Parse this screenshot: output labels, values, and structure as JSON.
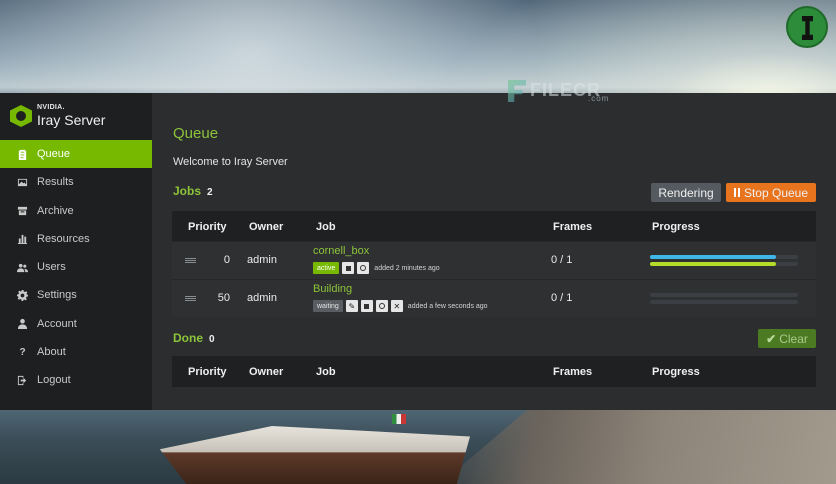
{
  "watermark": {
    "text": "FILECR",
    "sub": ".com"
  },
  "brand": {
    "small": "NVIDIA.",
    "name": "Iray Server"
  },
  "nav": [
    {
      "label": "Queue",
      "icon": "clipboard-icon",
      "active": true
    },
    {
      "label": "Results",
      "icon": "image-icon",
      "active": false
    },
    {
      "label": "Archive",
      "icon": "archive-icon",
      "active": false
    },
    {
      "label": "Resources",
      "icon": "bar-chart-icon",
      "active": false
    },
    {
      "label": "Users",
      "icon": "users-icon",
      "active": false
    },
    {
      "label": "Settings",
      "icon": "gear-icon",
      "active": false
    },
    {
      "label": "Account",
      "icon": "user-icon",
      "active": false
    },
    {
      "label": "About",
      "icon": "question-icon",
      "active": false
    },
    {
      "label": "Logout",
      "icon": "logout-icon",
      "active": false
    }
  ],
  "main": {
    "title": "Queue",
    "welcome": "Welcome to Iray Server",
    "jobs": {
      "label": "Jobs",
      "count": "2",
      "rendering_label": "Rendering",
      "stop_label": "Stop Queue",
      "columns": [
        "Priority",
        "Owner",
        "Job",
        "Frames",
        "Progress"
      ],
      "rows": [
        {
          "priority": "0",
          "owner": "admin",
          "job": "cornell_box",
          "status": "active",
          "added": "added 2 minutes ago",
          "frames": "0 / 1",
          "progress": [
            {
              "fraction": 0.85,
              "color": "#3fb6e8"
            },
            {
              "fraction": 0.85,
              "color": "#b6dc2a"
            }
          ]
        },
        {
          "priority": "50",
          "owner": "admin",
          "job": "Building",
          "status": "waiting",
          "added": "added a few seconds ago",
          "frames": "0 / 1",
          "progress": [
            {
              "fraction": 0,
              "color": "#3fb6e8"
            },
            {
              "fraction": 0,
              "color": "#b6dc2a"
            }
          ]
        }
      ]
    },
    "done": {
      "label": "Done",
      "count": "0",
      "clear_label": "Clear",
      "columns": [
        "Priority",
        "Owner",
        "Job",
        "Frames",
        "Progress"
      ]
    }
  },
  "colors": {
    "accent": "#76b900",
    "stop": "#e8741e",
    "clear": "#4c7a22"
  }
}
